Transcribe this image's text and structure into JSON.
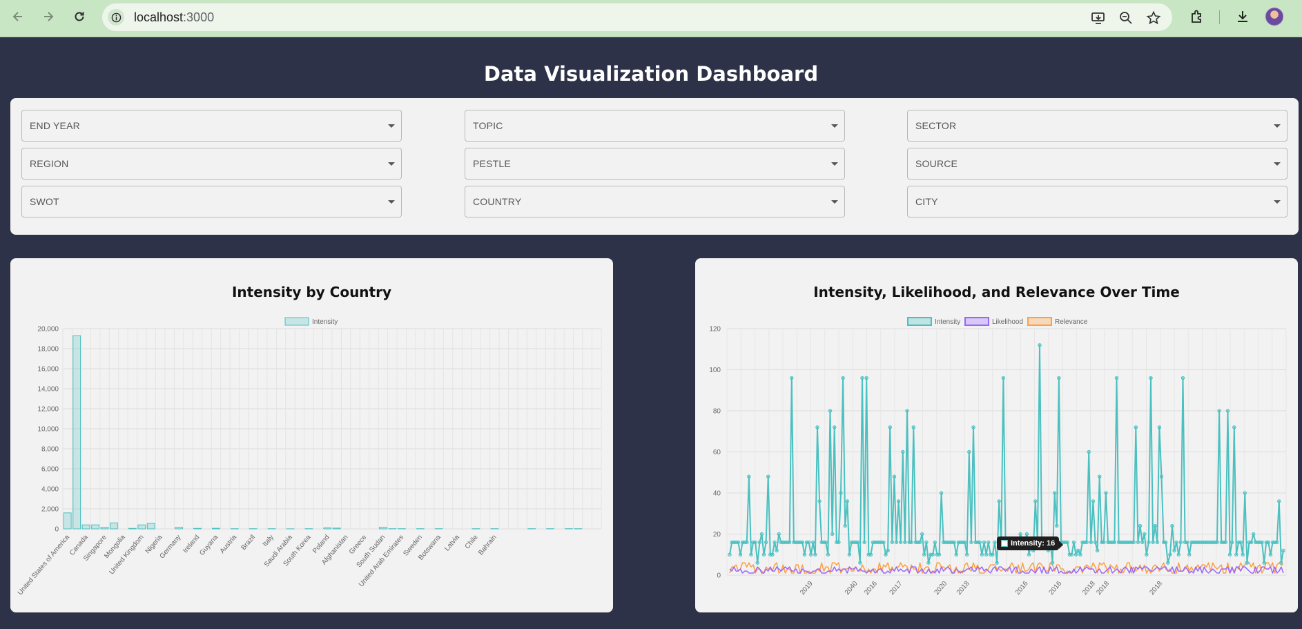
{
  "browser": {
    "url_host": "localhost",
    "url_port": ":3000",
    "icons": [
      "back-icon",
      "forward-icon",
      "reload-icon",
      "site-info-icon",
      "install-app-icon",
      "zoom-icon",
      "bookmark-star-icon",
      "extensions-icon",
      "downloads-icon",
      "profile-avatar"
    ]
  },
  "dashboard": {
    "title": "Data Visualization Dashboard"
  },
  "filters": [
    {
      "label": "END YEAR"
    },
    {
      "label": "TOPIC"
    },
    {
      "label": "SECTOR"
    },
    {
      "label": "REGION"
    },
    {
      "label": "PESTLE"
    },
    {
      "label": "SOURCE"
    },
    {
      "label": "SWOT"
    },
    {
      "label": "COUNTRY"
    },
    {
      "label": "CITY"
    }
  ],
  "bar_card": {
    "title": "Intensity by Country"
  },
  "line_card": {
    "title": "Intensity, Likelihood, and Relevance Over Time",
    "tooltip": "Intensity: 16"
  },
  "colors": {
    "intensity": "#4bc0c0",
    "likelihood": "#9966ff",
    "relevance": "#ff9f40",
    "background": "#2e3248",
    "panel": "#f2f2f2"
  },
  "chart_data": [
    {
      "type": "bar",
      "title": "Intensity by Country",
      "legend": "top",
      "grid": true,
      "series": [
        {
          "name": "Intensity"
        }
      ],
      "categories": [
        "United States of America",
        "Canada",
        "Singapore",
        "Mongolia",
        "United Kingdom",
        "Nigeria",
        "Germany",
        "Ireland",
        "Guyana",
        "Austria",
        "Brazil",
        "Italy",
        "Saudi Arabia",
        "South Korea",
        "Poland",
        "Afghanistan",
        "Greece",
        "South Sudan",
        "United Arab Emirates",
        "Sweden",
        "Botswana",
        "Latvia",
        "Chile",
        "Bahrain"
      ],
      "bar_labels_full": [
        "United States of America",
        "",
        "Canada",
        "",
        "Singapore",
        "",
        "Mongolia",
        "",
        "United Kingdom",
        "",
        "Nigeria",
        "",
        "Germany",
        "",
        "Ireland",
        "",
        "Guyana",
        "",
        "Austria",
        "",
        "Brazil",
        "",
        "Italy",
        "",
        "Saudi Arabia",
        "",
        "South Korea",
        "",
        "Poland",
        "",
        "Afghanistan",
        "",
        "Greece",
        "",
        "South Sudan",
        "",
        "United Arab Emirates",
        "",
        "Sweden",
        "",
        "Botswana",
        "",
        "Latvia",
        "",
        "Chile",
        "",
        "Bahrain",
        ""
      ],
      "values": [
        1600,
        19300,
        400,
        400,
        150,
        600,
        0,
        50,
        400,
        550,
        0,
        0,
        150,
        0,
        50,
        0,
        60,
        0,
        20,
        0,
        20,
        0,
        20,
        0,
        10,
        0,
        20,
        0,
        100,
        80,
        0,
        0,
        0,
        0,
        160,
        20,
        20,
        0,
        20,
        0,
        20,
        0,
        0,
        0,
        20,
        0,
        20,
        0,
        0,
        0,
        20,
        0,
        20,
        0,
        20,
        20,
        0,
        0
      ],
      "ylim": [
        0,
        20000
      ],
      "yticks": [
        "0",
        "2,000",
        "4,000",
        "6,000",
        "8,000",
        "10,000",
        "12,000",
        "14,000",
        "16,000",
        "18,000",
        "20,000"
      ]
    },
    {
      "type": "line",
      "title": "Intensity, Likelihood, and Relevance Over Time",
      "legend": "top",
      "grid": true,
      "series": [
        {
          "name": "Intensity",
          "typical_range": [
            6,
            96
          ],
          "peak": 112
        },
        {
          "name": "Likelihood",
          "typical_range": [
            1,
            4
          ]
        },
        {
          "name": "Relevance",
          "typical_range": [
            1,
            6
          ]
        }
      ],
      "x_tick_labels": [
        "2019",
        "2040",
        "2016",
        "2017",
        "2020",
        "2018",
        "2016",
        "2016",
        "2018",
        "2018",
        "2018"
      ],
      "ylim": [
        0,
        120
      ],
      "yticks": [
        "0",
        "20",
        "40",
        "60",
        "80",
        "100",
        "120"
      ]
    }
  ]
}
